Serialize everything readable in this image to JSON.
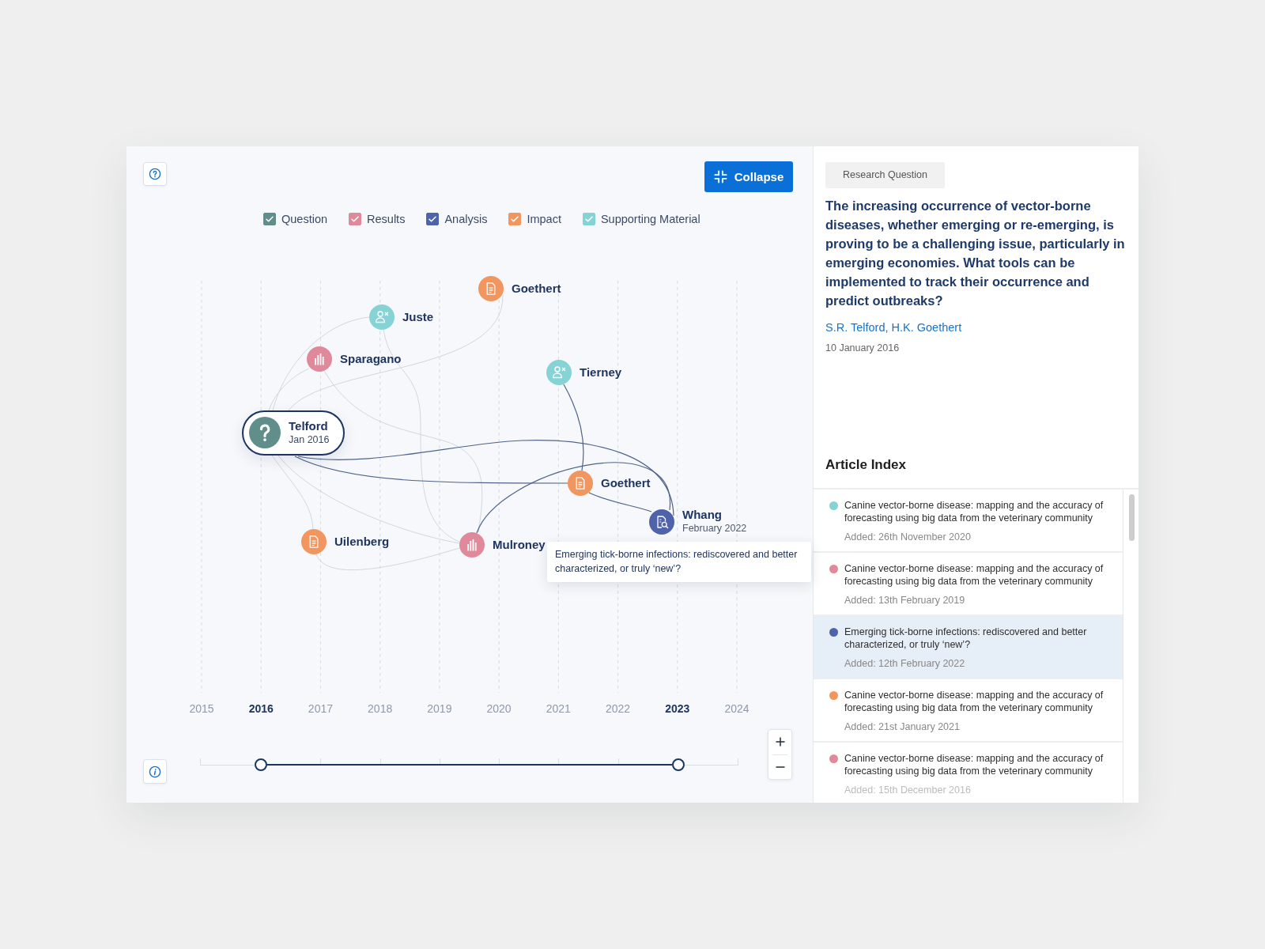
{
  "toolbar": {
    "collapse_button": "Collapse"
  },
  "legend": [
    {
      "label": "Question",
      "kind": "question",
      "color": "#5f8e8b",
      "checked": true
    },
    {
      "label": "Results",
      "kind": "results",
      "color": "#e0899a",
      "checked": true
    },
    {
      "label": "Analysis",
      "kind": "analysis",
      "color": "#4e63aa",
      "checked": true
    },
    {
      "label": "Impact",
      "kind": "impact",
      "color": "#f2965f",
      "checked": true
    },
    {
      "label": "Supporting Material",
      "kind": "supporting",
      "color": "#86d3d5",
      "checked": true
    }
  ],
  "graph": {
    "nodes": [
      {
        "name": "Goethert",
        "kind": "impact",
        "selected": false
      },
      {
        "name": "Juste",
        "kind": "supporting",
        "selected": false
      },
      {
        "name": "Sparagano",
        "kind": "results",
        "selected": false
      },
      {
        "name": "Tierney",
        "kind": "supporting",
        "selected": false
      },
      {
        "name": "Telford",
        "date": "Jan 2016",
        "kind": "question",
        "selected": true
      },
      {
        "name": "Goethert",
        "kind": "impact",
        "selected": false
      },
      {
        "name": "Uilenberg",
        "kind": "impact",
        "selected": false
      },
      {
        "name": "Mulroney",
        "kind": "results",
        "selected": false
      },
      {
        "name": "Whang",
        "date": "February 2022",
        "kind": "analysis",
        "selected": false,
        "tooltip": "Emerging tick-borne infections: rediscovered and better characterized, or truly ‘new’?"
      }
    ],
    "years": [
      {
        "label": "2015",
        "selected": false
      },
      {
        "label": "2016",
        "selected": true
      },
      {
        "label": "2017",
        "selected": false
      },
      {
        "label": "2018",
        "selected": false
      },
      {
        "label": "2019",
        "selected": false
      },
      {
        "label": "2020",
        "selected": false
      },
      {
        "label": "2021",
        "selected": false
      },
      {
        "label": "2022",
        "selected": false
      },
      {
        "label": "2023",
        "selected": true
      },
      {
        "label": "2024",
        "selected": false
      }
    ]
  },
  "timeline_slider": {
    "thumbs": [
      {
        "level": 0.113
      },
      {
        "level": 0.888
      }
    ]
  },
  "details": {
    "tag": "Research Question",
    "question": "The increasing occurrence of vector-borne diseases, whether emerging or re-emerging, is proving to be a challenging issue, particularly in emerging economies. What tools can be implemented to track their occurrence and predict outbreaks?",
    "authors": "S.R. Telford, H.K. Goethert",
    "date": "10 January 2016"
  },
  "article_index": {
    "title": "Article Index",
    "articles": [
      {
        "title": "Canine vector-borne disease: mapping and the accuracy of forecasting using big data from the veterinary community",
        "added": "Added: 26th November 2020",
        "color": "#86d3d5",
        "selected": false
      },
      {
        "title": "Canine vector-borne disease: mapping and the accuracy of forecasting using big data from the veterinary community",
        "added": "Added: 13th February 2019",
        "color": "#e0899a",
        "selected": false
      },
      {
        "title": "Emerging tick-borne infections: rediscovered and better characterized, or truly ‘new’?",
        "added": "Added: 12th February 2022",
        "color": "#4e63aa",
        "selected": true
      },
      {
        "title": "Canine vector-borne disease: mapping and the accuracy of forecasting using big data from the veterinary community",
        "added": "Added: 21st January 2021",
        "color": "#f2965f",
        "selected": false
      },
      {
        "title": "Canine vector-borne disease: mapping and the accuracy of forecasting using big data from the veterinary community",
        "added": "Added: 15th December 2016",
        "color": "#e0899a",
        "selected": false
      }
    ]
  }
}
